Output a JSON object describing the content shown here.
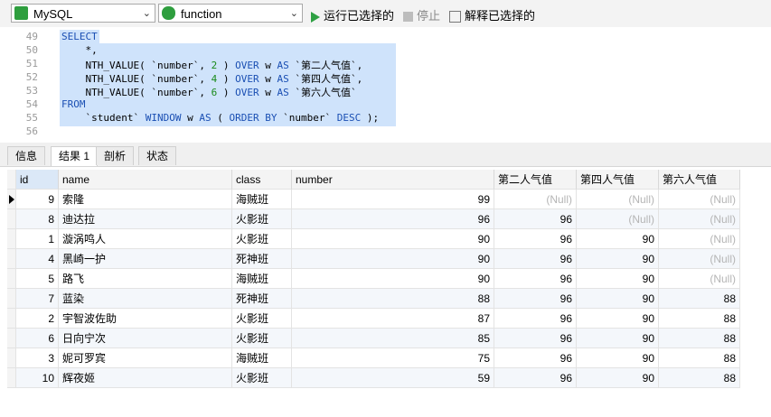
{
  "toolbar": {
    "connection": "MySQL",
    "database": "function",
    "run_selected": "运行已选择的",
    "stop": "停止",
    "explain_selected": "解释已选择的"
  },
  "editor": {
    "lines": [
      {
        "n": "49",
        "t": "SELECT"
      },
      {
        "n": "50",
        "t": "    *,"
      },
      {
        "n": "51",
        "t": "    NTH_VALUE( `number`, 2 ) OVER w AS `第二人气值`,"
      },
      {
        "n": "52",
        "t": "    NTH_VALUE( `number`, 4 ) OVER w AS `第四人气值`,"
      },
      {
        "n": "53",
        "t": "    NTH_VALUE( `number`, 6 ) OVER w AS `第六人气值`"
      },
      {
        "n": "54",
        "t": "FROM"
      },
      {
        "n": "55",
        "t": "    `student` WINDOW w AS ( ORDER BY `number` DESC );"
      },
      {
        "n": "56",
        "t": ""
      }
    ]
  },
  "tabs": [
    "信息",
    "结果 1",
    "剖析",
    "状态"
  ],
  "grid": {
    "columns": [
      "id",
      "name",
      "class",
      "number",
      "第二人气值",
      "第四人气值",
      "第六人气值"
    ],
    "rows": [
      [
        "9",
        "索隆",
        "海贼班",
        "99",
        "(Null)",
        "(Null)",
        "(Null)"
      ],
      [
        "8",
        "迪达拉",
        "火影班",
        "96",
        "96",
        "(Null)",
        "(Null)"
      ],
      [
        "1",
        "漩涡鸣人",
        "火影班",
        "90",
        "96",
        "90",
        "(Null)"
      ],
      [
        "4",
        "黑崎一护",
        "死神班",
        "90",
        "96",
        "90",
        "(Null)"
      ],
      [
        "5",
        "路飞",
        "海贼班",
        "90",
        "96",
        "90",
        "(Null)"
      ],
      [
        "7",
        "蓝染",
        "死神班",
        "88",
        "96",
        "90",
        "88"
      ],
      [
        "2",
        "宇智波佐助",
        "火影班",
        "87",
        "96",
        "90",
        "88"
      ],
      [
        "6",
        "日向宁次",
        "火影班",
        "85",
        "96",
        "90",
        "88"
      ],
      [
        "3",
        "妮可罗宾",
        "海贼班",
        "75",
        "96",
        "90",
        "88"
      ],
      [
        "10",
        "辉夜姬",
        "火影班",
        "59",
        "96",
        "90",
        "88"
      ]
    ]
  }
}
